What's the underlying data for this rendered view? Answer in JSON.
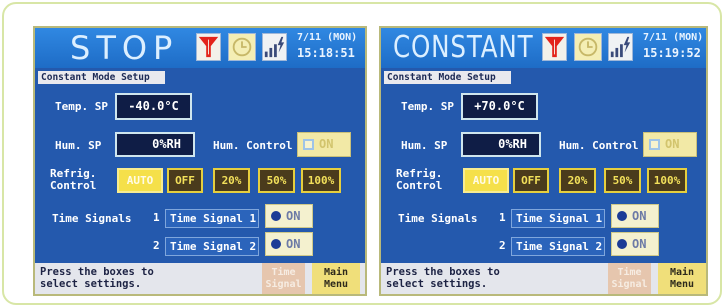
{
  "screens": [
    {
      "header": {
        "mode": "STOP",
        "date": "7/11 (MON)",
        "time": "15:18:51"
      },
      "status_icons": [
        "alarm-icon",
        "clock-icon",
        "power-signal-icon"
      ],
      "section_tab": "Constant Mode Setup",
      "temp": {
        "label": "Temp. SP",
        "value": "-40.0°C"
      },
      "hum": {
        "label": "Hum. SP",
        "value": "0%RH",
        "control_label": "Hum. Control",
        "control_button": "ON",
        "control_on": false
      },
      "refrig": {
        "label": "Refrig. Control",
        "options": [
          "AUTO",
          "OFF",
          "20%",
          "50%",
          "100%"
        ],
        "selected": "AUTO"
      },
      "time_signals": {
        "label": "Time Signals",
        "rows": [
          {
            "number": "1",
            "name": "Time Signal 1",
            "button": "ON",
            "on": true
          },
          {
            "number": "2",
            "name": "Time Signal 2",
            "button": "ON",
            "on": true
          }
        ]
      },
      "footer": {
        "hint": [
          "Press the boxes to",
          "select settings."
        ],
        "time_signal_button": "Time Signal",
        "main_menu_button": "Main Menu"
      }
    },
    {
      "header": {
        "mode": "CONSTANT",
        "date": "7/11 (MON)",
        "time": "15:19:52"
      },
      "status_icons": [
        "alarm-icon",
        "clock-icon",
        "power-signal-icon"
      ],
      "section_tab": "Constant Mode Setup",
      "temp": {
        "label": "Temp. SP",
        "value": "+70.0°C"
      },
      "hum": {
        "label": "Hum. SP",
        "value": "0%RH",
        "control_label": "Hum. Control",
        "control_button": "ON",
        "control_on": false
      },
      "refrig": {
        "label": "Refrig. Control",
        "options": [
          "AUTO",
          "OFF",
          "20%",
          "50%",
          "100%"
        ],
        "selected": "AUTO"
      },
      "time_signals": {
        "label": "Time Signals",
        "rows": [
          {
            "number": "1",
            "name": "Time Signal 1",
            "button": "ON",
            "on": true
          },
          {
            "number": "2",
            "name": "Time Signal 2",
            "button": "ON",
            "on": true
          }
        ]
      },
      "footer": {
        "hint": [
          "Press the boxes to",
          "select settings."
        ],
        "time_signal_button": "Time Signal",
        "main_menu_button": "Main Menu"
      }
    }
  ],
  "colors": {
    "frame_border": "#d8e6a6",
    "header_blue": "#2277d4",
    "screen_blue": "#2459ad",
    "value_box": "#0f1d46",
    "selected_yellow": "#f5e04a",
    "option_brown": "#4a3b1c",
    "option_border": "#e6cf3e",
    "alarm_red": "#e3231b",
    "main_menu_yellow": "#f0df7a"
  }
}
